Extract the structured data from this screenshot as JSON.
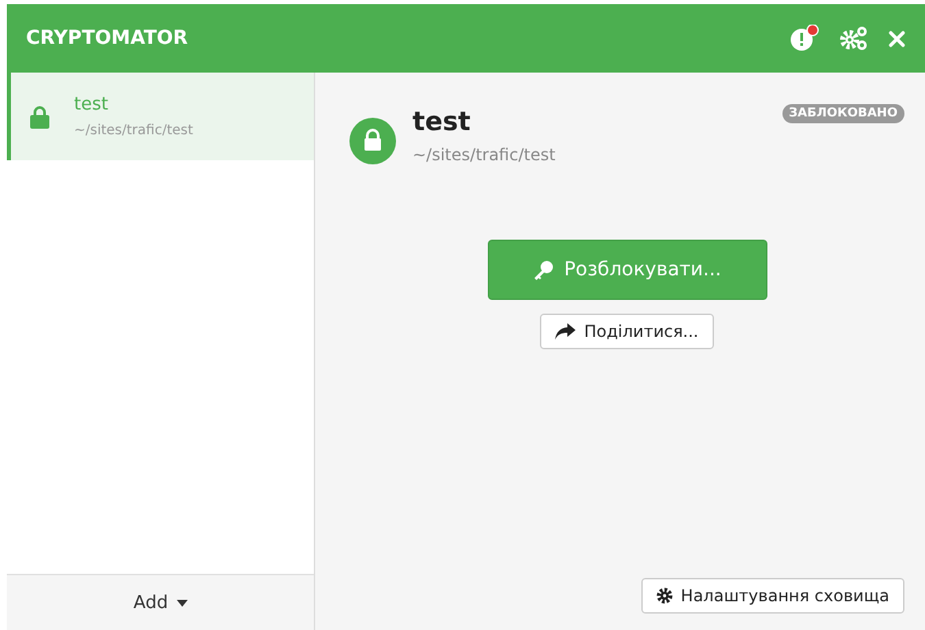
{
  "window": {
    "title": "CRYPTOMATOR",
    "has_notification": true
  },
  "vaults": [
    {
      "name": "test",
      "path": "~/sites/trafic/test",
      "selected": true,
      "locked": true
    }
  ],
  "add_button": {
    "label": "Add"
  },
  "detail": {
    "name": "test",
    "path": "~/sites/trafic/test",
    "status": "ЗАБЛОКОВАНО",
    "locked": true,
    "unlock_button": "Розблокувати...",
    "share_button": "Поділитися...",
    "settings_button": "Налаштування сховища"
  }
}
